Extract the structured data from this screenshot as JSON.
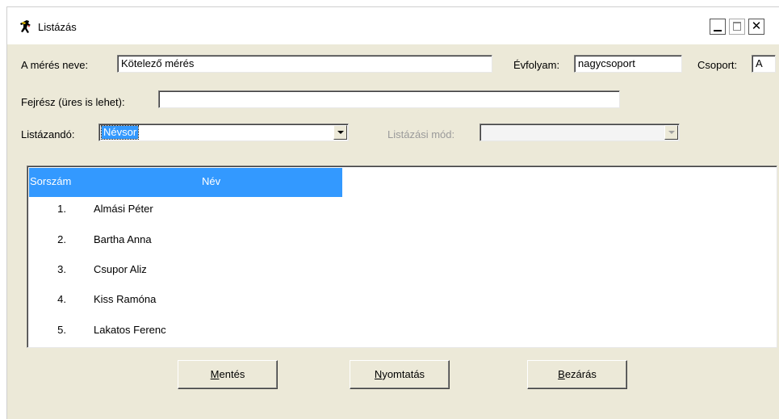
{
  "window": {
    "title": "Listázás"
  },
  "form": {
    "meres_label": "A mérés neve:",
    "meres_value": "Kötelező mérés",
    "evfolyam_label": "Évfolyam:",
    "evfolyam_value": "nagycsoport",
    "csoport_label": "Csoport:",
    "csoport_value": "A",
    "fejresz_label": "Fejrész (üres is lehet):",
    "fejresz_value": "",
    "listazando_label": "Listázandó:",
    "listazando_value": "Névsor",
    "listazasi_mod_label": "Listázási mód:",
    "listazasi_mod_value": ""
  },
  "list": {
    "headers": {
      "number": "Sorszám",
      "name": "Név"
    },
    "rows": [
      {
        "number": "1.",
        "name": "Almási Péter"
      },
      {
        "number": "2.",
        "name": "Bartha Anna"
      },
      {
        "number": "3.",
        "name": "Csupor Aliz"
      },
      {
        "number": "4.",
        "name": "Kiss Ramóna"
      },
      {
        "number": "5.",
        "name": "Lakatos Ferenc"
      }
    ]
  },
  "buttons": {
    "save_first": "M",
    "save_rest": "entés",
    "print_first": "N",
    "print_rest": "yomtatás",
    "close_first": "B",
    "close_rest": "ezárás"
  },
  "icons": {
    "app": "running-person-icon",
    "minimize": "minimize-icon",
    "maximize": "maximize-icon",
    "close": "close-icon"
  },
  "colors": {
    "selection": "#3399ff",
    "face": "#ece9d8"
  }
}
